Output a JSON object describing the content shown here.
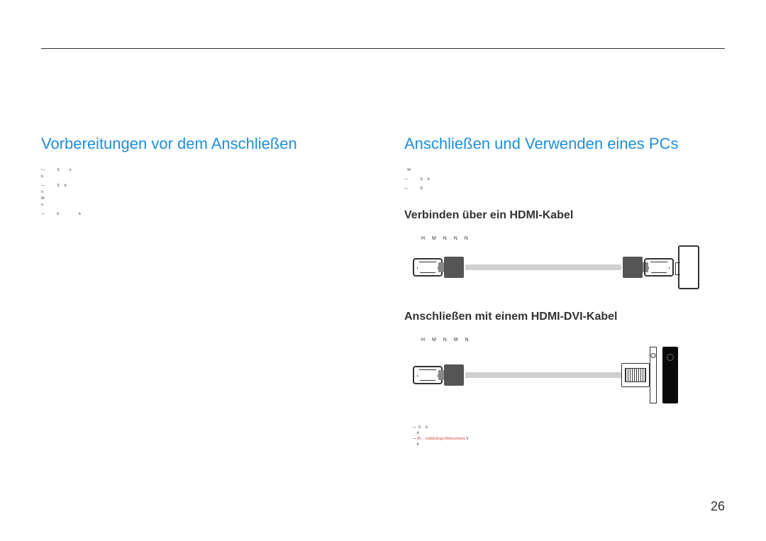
{
  "left": {
    "heading": "Vorbereitungen vor dem Anschließen",
    "p1a": "S",
    "p1b": "n",
    "p1c": "b",
    "p2a": "S",
    "p2b": "b",
    "p2c": "n",
    "p2d": "W",
    "p2e": "u",
    "p3a": "b",
    "p3b": "b"
  },
  "right": {
    "heading": "Anschließen und Verwenden eines PCs",
    "intro1": "W",
    "intro2a": "S",
    "intro2b": "b",
    "intro3": "D",
    "sub1": "Verbinden über ein HDMI-Kabel",
    "port1": "H  M  N   N    N",
    "sub2": "Anschließen mit einem HDMI-DVI-Kabel",
    "port2": "H   M  N    M  N",
    "foot1a": "S",
    "foot1b": "b",
    "foot1c": "d",
    "foot2pre": "Bt",
    "foot2hl": "eraktiv&ogo-Beleuchtung",
    "foot2post": "V",
    "foot2end": "b"
  },
  "page": "26"
}
